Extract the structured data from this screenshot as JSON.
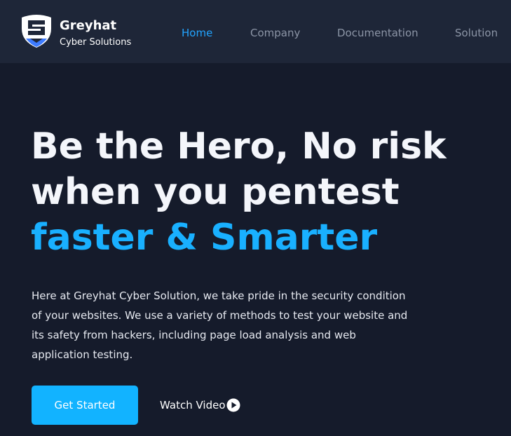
{
  "brand": {
    "name": "Greyhat",
    "tagline": "Cyber Solutions",
    "logo_icon": "shield-logo-icon"
  },
  "nav": {
    "items": [
      {
        "label": "Home",
        "active": true
      },
      {
        "label": "Company",
        "active": false
      },
      {
        "label": "Documentation",
        "active": false
      },
      {
        "label": "Solution",
        "active": false
      }
    ]
  },
  "hero": {
    "title_line1": "Be the Hero, No risk",
    "title_line2": "when you pentest",
    "title_line3": "faster & Smarter",
    "description": "Here at Greyhat Cyber Solution, we take pride in the security condition of your websites. We use a variety of methods to test your website and its safety from hackers, including page load analysis and web application testing.",
    "primary_button": "Get Started",
    "video_button": "Watch Video",
    "video_icon": "play-circle-icon"
  },
  "colors": {
    "background": "#151b2b",
    "navbar": "#1e2638",
    "accent": "#19b0ff",
    "button": "#12b3ff",
    "nav_inactive": "#8c95a6"
  }
}
